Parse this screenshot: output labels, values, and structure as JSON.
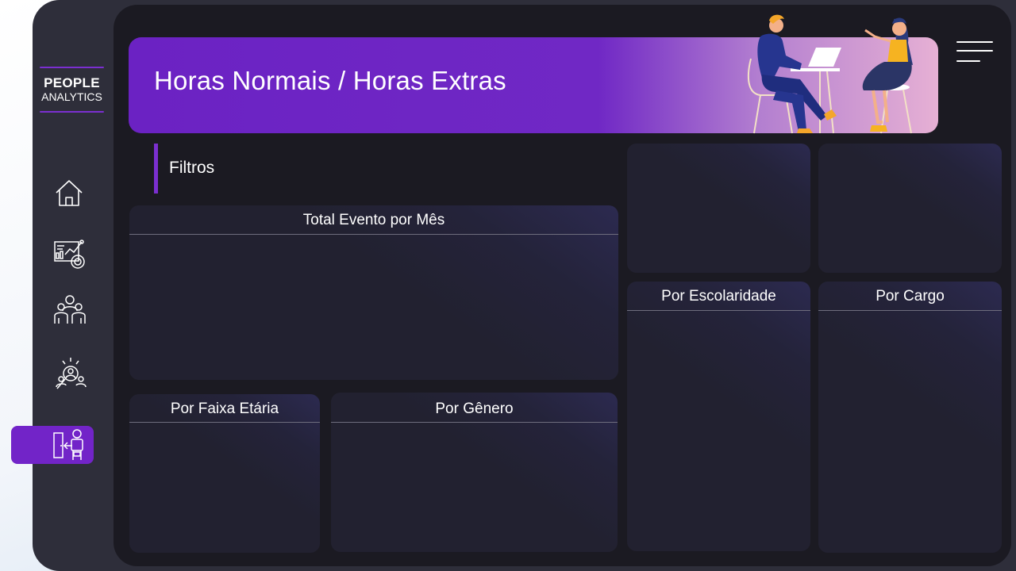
{
  "brand": {
    "line1": "PEOPLE",
    "line2": "ANALYTICS"
  },
  "sidebar": {
    "items": [
      {
        "icon": "home-icon"
      },
      {
        "icon": "analytics-report-icon"
      },
      {
        "icon": "team-icon"
      },
      {
        "icon": "talent-search-icon"
      },
      {
        "icon": "employee-exit-icon",
        "active": true
      }
    ]
  },
  "header": {
    "title": "Horas Normais / Horas Extras",
    "menu_icon": "hamburger-menu-icon"
  },
  "filters": {
    "label": "Filtros"
  },
  "panels": {
    "total_evento_mes": "Total Evento por Mês",
    "faixa_etaria": "Por Faixa Etária",
    "genero": "Por Gênero",
    "escolaridade": "Por Escolaridade",
    "cargo": "Por Cargo"
  },
  "colors": {
    "accent": "#7224c8",
    "background": "#1b1a22",
    "sidebar": "#2e2e3a"
  }
}
